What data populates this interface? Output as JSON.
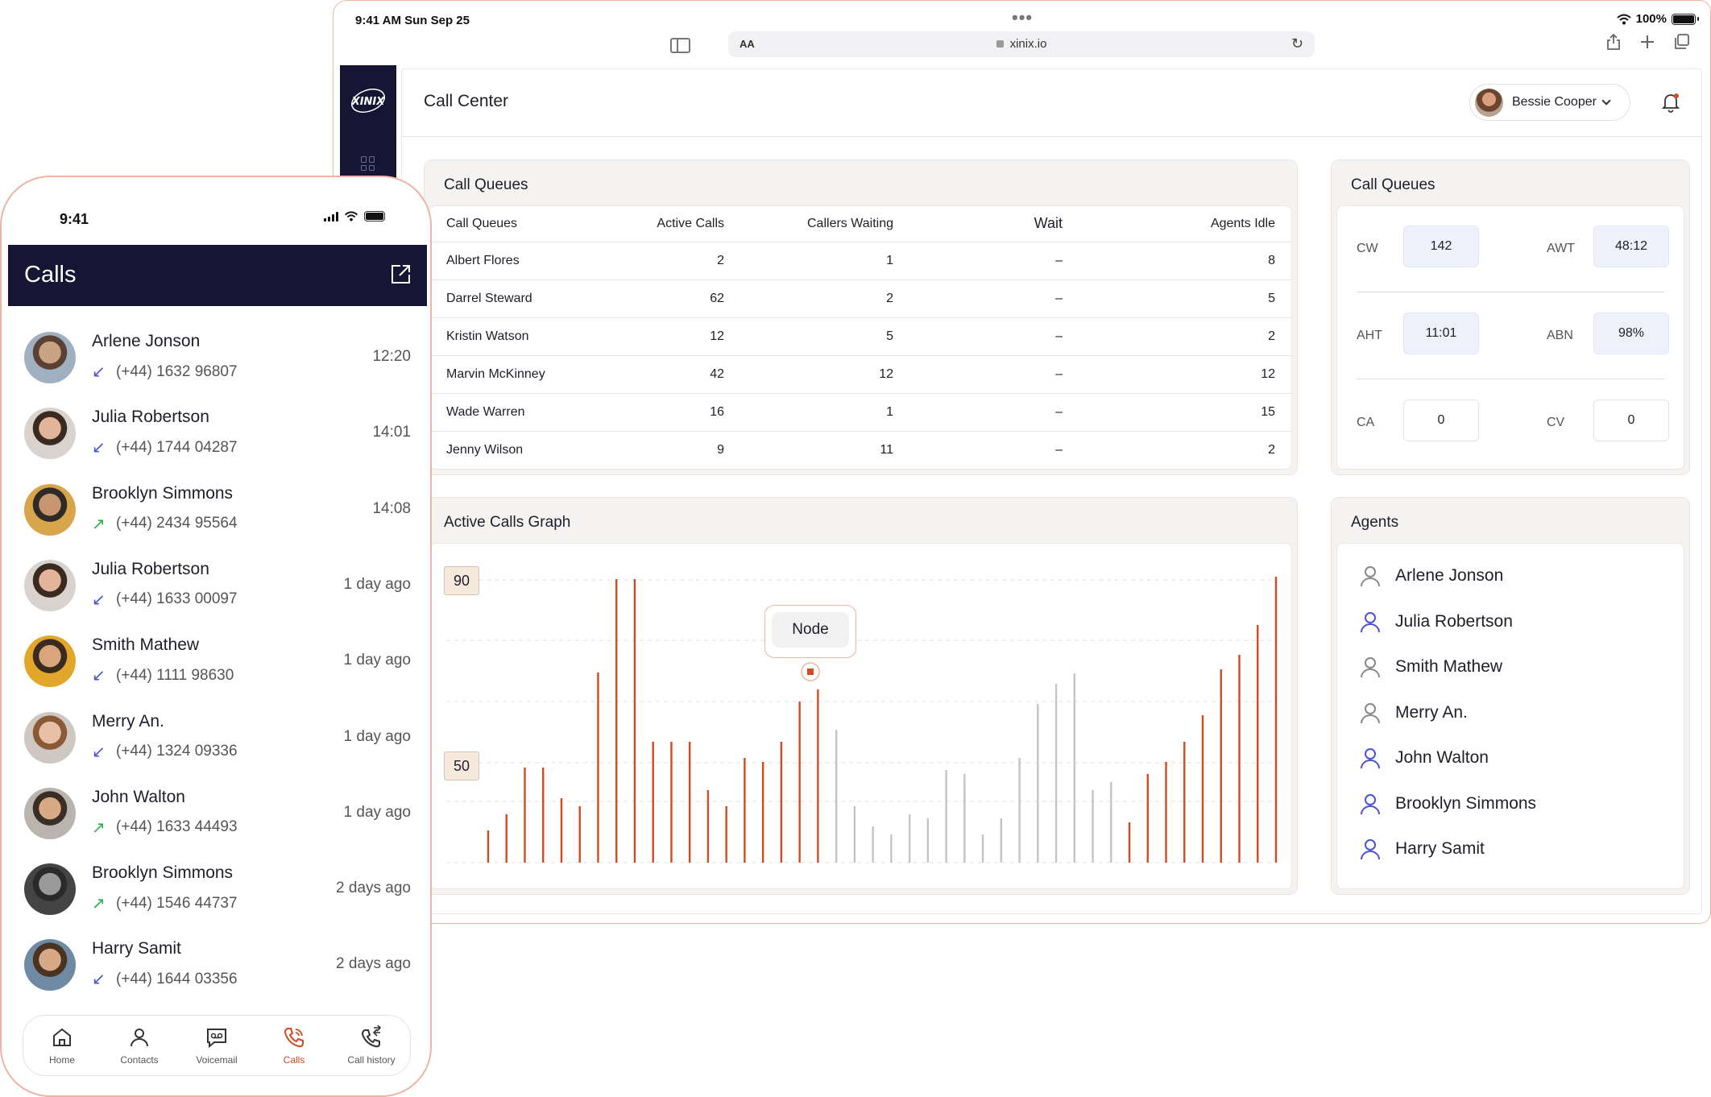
{
  "tablet": {
    "status": {
      "time": "9:41 AM  Sun Sep 25",
      "battery": "100%"
    },
    "browser": {
      "aa": "AA",
      "url": "xinix.io"
    },
    "logo_text": "XINIX",
    "page_title": "Call Center",
    "user": {
      "name": "Bessie Cooper"
    },
    "queues_table": {
      "title": "Call Queues",
      "headers": [
        "Call Queues",
        "Active Calls",
        "Callers Waiting",
        "Wait",
        "Agents Idle"
      ],
      "rows": [
        [
          "Albert Flores",
          "2",
          "1",
          "–",
          "8"
        ],
        [
          "Darrel Steward",
          "62",
          "2",
          "–",
          "5"
        ],
        [
          "Kristin Watson",
          "12",
          "5",
          "–",
          "2"
        ],
        [
          "Marvin McKinney",
          "42",
          "12",
          "–",
          "12"
        ],
        [
          "Wade Warren",
          "16",
          "1",
          "–",
          "15"
        ],
        [
          "Jenny Wilson",
          "9",
          "11",
          "–",
          "2"
        ]
      ]
    },
    "queue_stats": {
      "title": "Call Queues",
      "stats": [
        {
          "label": "CW",
          "value": "142"
        },
        {
          "label": "AWT",
          "value": "48:12"
        },
        {
          "label": "AHT",
          "value": "11:01"
        },
        {
          "label": "ABN",
          "value": "98%"
        },
        {
          "label": "CA",
          "value": "0"
        },
        {
          "label": "CV",
          "value": "0"
        }
      ]
    },
    "graph": {
      "title": "Active Calls Graph",
      "tag_high": "90",
      "tag_low": "50",
      "tooltip": "Node"
    },
    "agents": {
      "title": "Agents",
      "list": [
        "Arlene Jonson",
        "Julia Robertson",
        "Smith Mathew",
        "Merry An.",
        "John Walton",
        "Brooklyn Simmons",
        "Harry Samit"
      ]
    },
    "colors": {
      "accent": "#d24a22",
      "navy": "#161634",
      "muted_bar": "#c4c4c4"
    }
  },
  "phone": {
    "time": "9:41",
    "title": "Calls",
    "calls": [
      {
        "name": "Arlene Jonson",
        "number": "(+44) 1632 96807",
        "time": "12:20",
        "dir": "in"
      },
      {
        "name": "Julia Robertson",
        "number": "(+44) 1744 04287",
        "time": "14:01",
        "dir": "in"
      },
      {
        "name": "Brooklyn Simmons",
        "number": "(+44) 2434 95564",
        "time": "14:08",
        "dir": "out"
      },
      {
        "name": "Julia Robertson",
        "number": "(+44) 1633 00097",
        "time": "1 day ago",
        "dir": "in"
      },
      {
        "name": "Smith Mathew",
        "number": "(+44) 1111 98630",
        "time": "1 day ago",
        "dir": "in"
      },
      {
        "name": "Merry An.",
        "number": "(+44) 1324 09336",
        "time": "1 day ago",
        "dir": "in"
      },
      {
        "name": "John Walton",
        "number": "(+44) 1633 44493",
        "time": "1 day ago",
        "dir": "out"
      },
      {
        "name": "Brooklyn Simmons",
        "number": "(+44) 1546 44737",
        "time": "2 days ago",
        "dir": "out"
      },
      {
        "name": "Harry Samit",
        "number": "(+44) 1644 03356",
        "time": "2 days ago",
        "dir": "in"
      }
    ],
    "tabs": [
      {
        "label": "Home",
        "icon": "home-icon"
      },
      {
        "label": "Contacts",
        "icon": "contacts-icon"
      },
      {
        "label": "Voicemail",
        "icon": "voicemail-icon"
      },
      {
        "label": "Calls",
        "icon": "calls-icon",
        "active": true
      },
      {
        "label": "Call history",
        "icon": "call-history-icon"
      }
    ]
  }
}
